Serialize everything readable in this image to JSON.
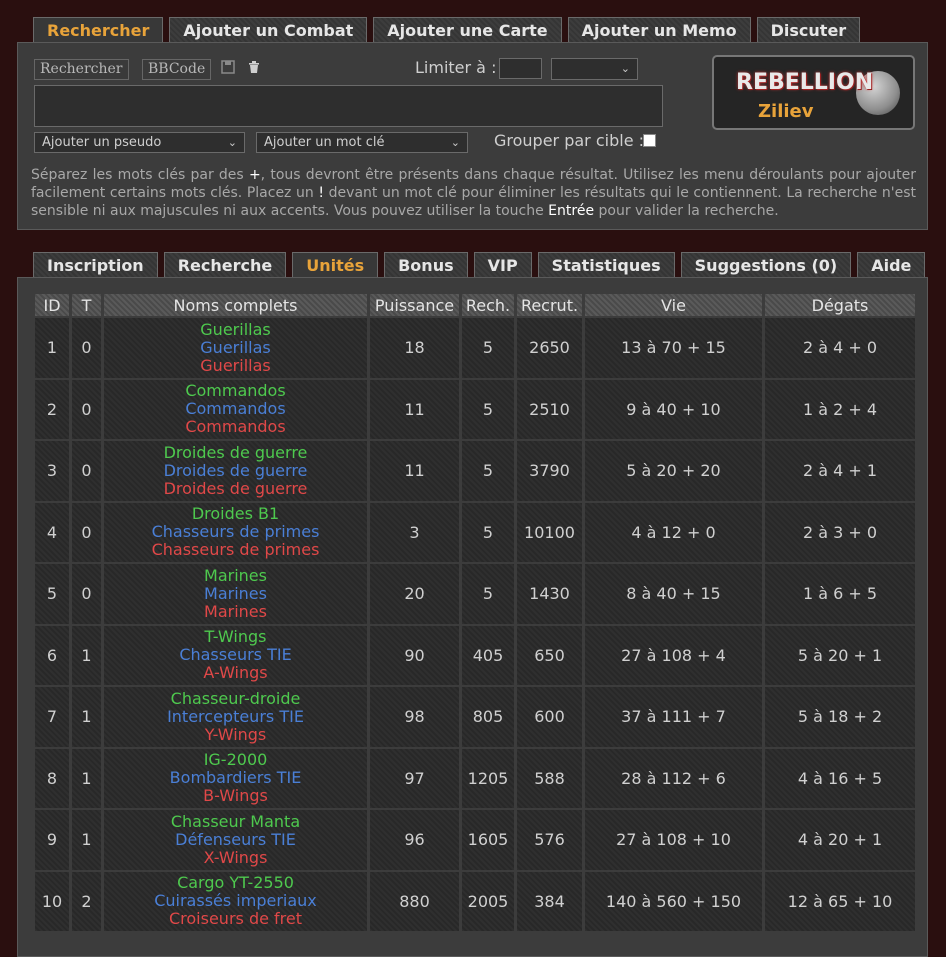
{
  "top_tabs": [
    {
      "label": "Rechercher",
      "active": true
    },
    {
      "label": "Ajouter un Combat",
      "active": false
    },
    {
      "label": "Ajouter une Carte",
      "active": false
    },
    {
      "label": "Ajouter un Memo",
      "active": false
    },
    {
      "label": "Discuter",
      "active": false
    }
  ],
  "search": {
    "search_button": "Rechercher",
    "bbcode_button": "BBCode",
    "save_icon": "floppy-disk-icon",
    "delete_icon": "trash-icon",
    "limit_label": "Limiter à :",
    "limit_value": "",
    "limit_unit_value": "",
    "textarea_value": "",
    "pseudo_select": "Ajouter un pseudo",
    "keyword_select": "Ajouter un mot clé",
    "group_label": "Grouper par cible :",
    "group_checked": false,
    "help_1": "Séparez les mots clés par des ",
    "help_plus": "+",
    "help_2": ", tous devront être présents dans chaque résultat. Utilisez les menu déroulants pour ajouter facilement certains mots clés. Placez un ",
    "help_bang": "!",
    "help_3": " devant un mot clé pour éliminer les résultats qui le contiennent. La recherche n'est sensible ni aux majuscules ni aux accents. Vous pouvez utiliser la touche ",
    "help_enter": "Entrée",
    "help_4": " pour valider la recherche."
  },
  "logo": {
    "brand": "REBELLION",
    "user": "Ziliev"
  },
  "section_tabs": [
    {
      "label": "Inscription",
      "active": false
    },
    {
      "label": "Recherche",
      "active": false
    },
    {
      "label": "Unités",
      "active": true
    },
    {
      "label": "Bonus",
      "active": false
    },
    {
      "label": "VIP",
      "active": false
    },
    {
      "label": "Statistiques",
      "active": false
    },
    {
      "label": "Suggestions (0)",
      "active": false
    },
    {
      "label": "Aide",
      "active": false
    }
  ],
  "colors": {
    "green": "#4ec94e",
    "blue": "#4a7fd6",
    "red": "#e04848",
    "accent": "#e8a33a"
  },
  "units": {
    "headers": [
      "ID",
      "T",
      "Noms complets",
      "Puissance",
      "Rech.",
      "Recrut.",
      "Vie",
      "Dégats"
    ],
    "rows": [
      {
        "id": "1",
        "t": "0",
        "green": "Guerillas",
        "blue": "Guerillas",
        "red": "Guerillas",
        "puissance": "18",
        "rech": "5",
        "recrut": "2650",
        "vie": "13 à 70 + 15",
        "degats": "2 à 4 + 0"
      },
      {
        "id": "2",
        "t": "0",
        "green": "Commandos",
        "blue": "Commandos",
        "red": "Commandos",
        "puissance": "11",
        "rech": "5",
        "recrut": "2510",
        "vie": "9 à 40 + 10",
        "degats": "1 à 2 + 4"
      },
      {
        "id": "3",
        "t": "0",
        "green": "Droides de guerre",
        "blue": "Droides de guerre",
        "red": "Droides de guerre",
        "puissance": "11",
        "rech": "5",
        "recrut": "3790",
        "vie": "5 à 20 + 20",
        "degats": "2 à 4 + 1"
      },
      {
        "id": "4",
        "t": "0",
        "green": "Droides B1",
        "blue": "Chasseurs de primes",
        "red": "Chasseurs de primes",
        "puissance": "3",
        "rech": "5",
        "recrut": "10100",
        "vie": "4 à 12 + 0",
        "degats": "2 à 3 + 0"
      },
      {
        "id": "5",
        "t": "0",
        "green": "Marines",
        "blue": "Marines",
        "red": "Marines",
        "puissance": "20",
        "rech": "5",
        "recrut": "1430",
        "vie": "8 à 40 + 15",
        "degats": "1 à 6 + 5"
      },
      {
        "id": "6",
        "t": "1",
        "green": "T-Wings",
        "blue": "Chasseurs TIE",
        "red": "A-Wings",
        "puissance": "90",
        "rech": "405",
        "recrut": "650",
        "vie": "27 à 108 + 4",
        "degats": "5 à 20 + 1"
      },
      {
        "id": "7",
        "t": "1",
        "green": "Chasseur-droide",
        "blue": "Intercepteurs TIE",
        "red": "Y-Wings",
        "puissance": "98",
        "rech": "805",
        "recrut": "600",
        "vie": "37 à 111 + 7",
        "degats": "5 à 18 + 2"
      },
      {
        "id": "8",
        "t": "1",
        "green": "IG-2000",
        "blue": "Bombardiers TIE",
        "red": "B-Wings",
        "puissance": "97",
        "rech": "1205",
        "recrut": "588",
        "vie": "28 à 112 + 6",
        "degats": "4 à 16 + 5"
      },
      {
        "id": "9",
        "t": "1",
        "green": "Chasseur Manta",
        "blue": "Défenseurs TIE",
        "red": "X-Wings",
        "puissance": "96",
        "rech": "1605",
        "recrut": "576",
        "vie": "27 à 108 + 10",
        "degats": "4 à 20 + 1"
      },
      {
        "id": "10",
        "t": "2",
        "green": "Cargo YT-2550",
        "blue": "Cuirassés imperiaux",
        "red": "Croiseurs de fret",
        "puissance": "880",
        "rech": "2005",
        "recrut": "384",
        "vie": "140 à 560 + 150",
        "degats": "12 à 65 + 10"
      }
    ]
  }
}
